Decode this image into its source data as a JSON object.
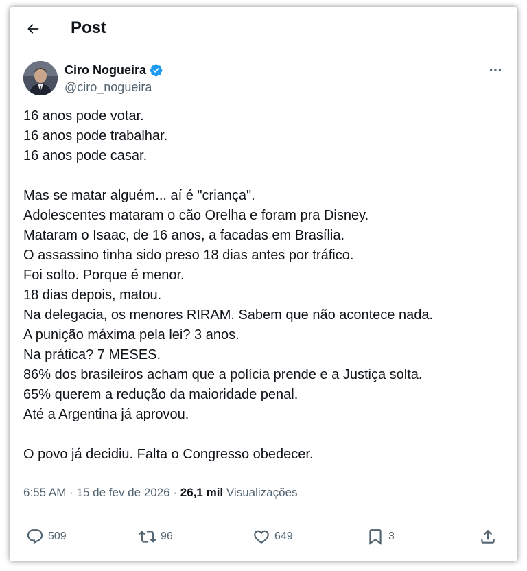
{
  "header": {
    "title": "Post",
    "back_icon": "arrow-left-icon"
  },
  "author": {
    "name": "Ciro Nogueira",
    "handle": "@ciro_nogueira",
    "verified": true,
    "verified_color": "#1d9bf0"
  },
  "post": {
    "text_lines": [
      "16 anos pode votar.",
      "16 anos pode trabalhar.",
      "16 anos pode casar.",
      "",
      "Mas se matar alguém... aí é \"criança\".",
      "Adolescentes mataram o cão Orelha e foram pra Disney.",
      "Mataram o Isaac, de 16 anos, a facadas em Brasília.",
      "O assassino tinha sido preso 18 dias antes por tráfico.",
      "Foi solto. Porque é menor.",
      "18 dias depois, matou.",
      "Na delegacia, os menores RIRAM. Sabem que não acontece nada.",
      "A punição máxima pela lei? 3 anos.",
      "Na prática? 7 MESES.",
      "86% dos brasileiros acham que a polícia prende e a Justiça solta.",
      "65% querem a redução da maioridade penal.",
      "Até a Argentina já aprovou.",
      "",
      "O povo já decidiu. Falta o Congresso obedecer."
    ],
    "time": "6:55 AM",
    "separator": "·",
    "date": "15 de fev de 2026",
    "views_count": "26,1 mil",
    "views_label": "Visualizações"
  },
  "actions": {
    "replies": "509",
    "reposts": "96",
    "likes": "649",
    "bookmarks": "3"
  },
  "icons": [
    "arrow-left-icon",
    "verified-badge-icon",
    "more-icon",
    "reply-icon",
    "repost-icon",
    "like-icon",
    "bookmark-icon",
    "share-icon"
  ],
  "colors": {
    "text": "#0f1419",
    "secondary": "#536471",
    "accent": "#1d9bf0"
  }
}
